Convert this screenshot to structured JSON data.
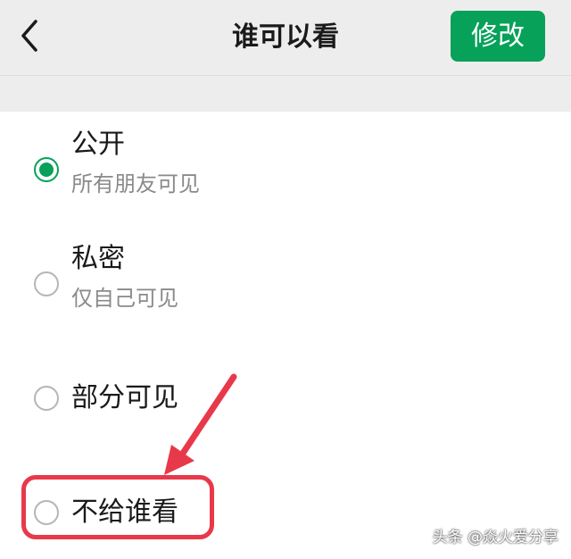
{
  "header": {
    "title": "谁可以看",
    "edit_label": "修改"
  },
  "options": [
    {
      "title": "公开",
      "subtitle": "所有朋友可见",
      "selected": true
    },
    {
      "title": "私密",
      "subtitle": "仅自己可见",
      "selected": false
    },
    {
      "title": "部分可见",
      "selected": false
    },
    {
      "title": "不给谁看",
      "selected": false
    }
  ],
  "watermark": "头条 @焱火爱分享",
  "colors": {
    "accent": "#07a15a",
    "annotation": "#e8394a"
  }
}
